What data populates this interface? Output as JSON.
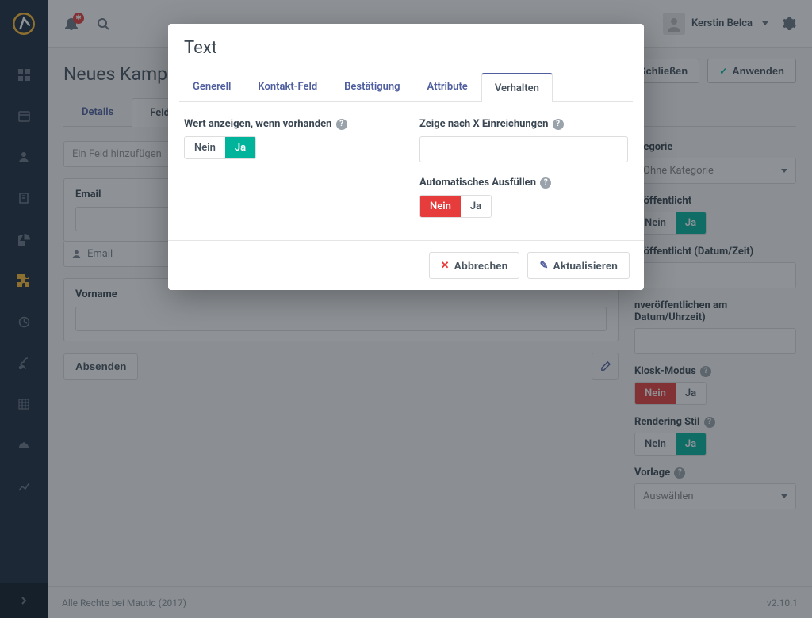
{
  "header": {
    "user_name": "Kerstin Belca"
  },
  "page": {
    "title": "Neues Kampag",
    "btn_save_close": "& Schließen",
    "btn_apply": "Anwenden"
  },
  "tabs": {
    "details": "Details",
    "fields": "Felder"
  },
  "fields": {
    "add_placeholder": "Ein Feld hinzufügen",
    "email_label": "Email",
    "email_sub": "Email",
    "vorname_label": "Vorname",
    "submit": "Absenden"
  },
  "sidebar_right": {
    "kategorie_label": "ategorie",
    "kategorie_value": "Ohne Kategorie",
    "veroeff_label": "eröffentlicht",
    "nein": "Nein",
    "ja": "Ja",
    "veroeff_datum_label": "eröffentlicht (Datum/Zeit)",
    "unveroeff_label": "nveröffentlichen am Datum/Uhrzeit)",
    "kiosk_label": "Kiosk-Modus",
    "render_label": "Rendering Stil",
    "vorlage_label": "Vorlage",
    "vorlage_value": "Auswählen"
  },
  "footer": {
    "copyright": "Alle Rechte bei Mautic (2017)",
    "version": "v2.10.1"
  },
  "modal": {
    "title": "Text",
    "tabs": {
      "generell": "Generell",
      "kontakt": "Kontakt-Feld",
      "bestaetigung": "Bestätigung",
      "attribute": "Attribute",
      "verhalten": "Verhalten"
    },
    "wert_label": "Wert anzeigen, wenn vorhanden",
    "zeige_label": "Zeige nach X Einreichungen",
    "auto_label": "Automatisches Ausfüllen",
    "nein": "Nein",
    "ja": "Ja",
    "cancel": "Abbrechen",
    "update": "Aktualisieren"
  }
}
